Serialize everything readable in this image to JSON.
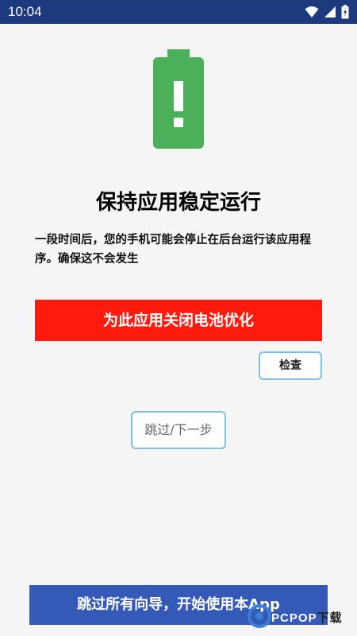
{
  "status_bar": {
    "time": "10:04",
    "icons": [
      "wifi-icon",
      "signal-icon",
      "battery-icon"
    ]
  },
  "illustration": {
    "icon": "battery-alert-icon",
    "color": "#4caf5a"
  },
  "main": {
    "title": "保持应用稳定运行",
    "description": "一段时间后，您的手机可能会停止在后台运行该应用程序。确保这不会发生",
    "optimize_button_label": "为此应用关闭电池优化",
    "check_button_label": "检查",
    "skip_next_button_label": "跳过/下一步",
    "skip_all_button_label": "跳过所有向导，开始使用本App"
  },
  "watermark": {
    "brand": "PCPOP",
    "suffix": "下载"
  },
  "colors": {
    "status_bar": "#1e3a7e",
    "optimize_button": "#ff1a0e",
    "skip_all_button": "#3559b6",
    "outline": "#7ec1e4",
    "background": "#f5f5f5"
  }
}
